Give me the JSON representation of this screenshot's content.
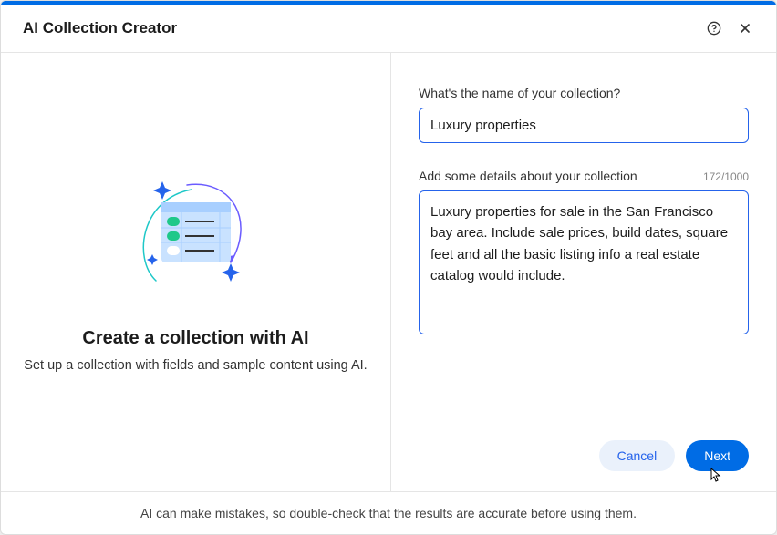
{
  "header": {
    "title": "AI Collection Creator"
  },
  "left": {
    "heading": "Create a collection with AI",
    "subheading": "Set up a collection with fields and sample content using AI."
  },
  "form": {
    "name_label": "What's the name of your collection?",
    "name_value": "Luxury properties",
    "details_label": "Add some details about your collection",
    "details_counter": "172/1000",
    "details_value": "Luxury properties for sale in the San Francisco bay area. Include sale prices, build dates, square feet and all the basic listing info a real estate catalog would include."
  },
  "actions": {
    "cancel": "Cancel",
    "next": "Next"
  },
  "footer": {
    "disclaimer": "AI can make mistakes, so double-check that the results are accurate before using them."
  }
}
